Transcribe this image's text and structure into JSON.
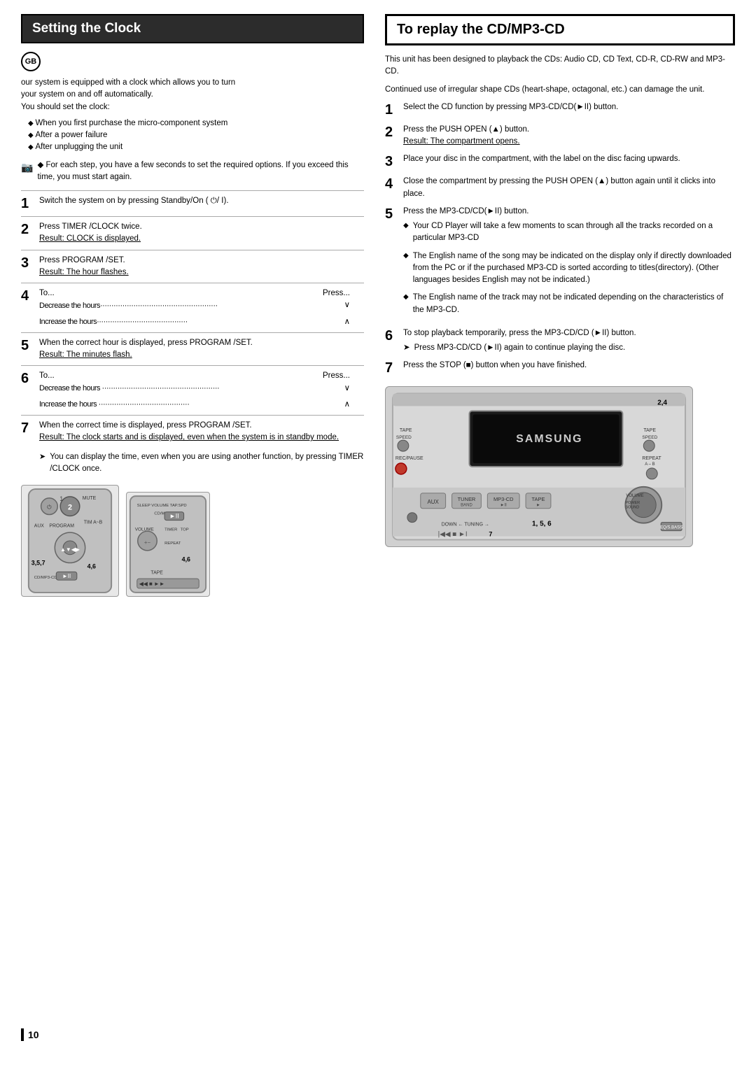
{
  "left": {
    "header": "Setting the Clock",
    "gb_label": "GB",
    "intro": [
      "our system is equipped with a clock which allows you to turn",
      "your system on and off automatically.",
      "You should set the clock:"
    ],
    "bullets": [
      "When you first purchase the micro-component system",
      "After a power failure",
      "After unplugging the unit"
    ],
    "note": "For each step, you have a few seconds to set the required options. If you exceed this time, you must start again.",
    "steps": [
      {
        "num": "1",
        "text": "Switch the system on by pressing Standby/On ( ⏻/ I)."
      },
      {
        "num": "2",
        "text": "Press TIMER /CLOCK twice.",
        "result": "Result: CLOCK is displayed."
      },
      {
        "num": "3",
        "text": "Press PROGRAM /SET.",
        "result": "Result: The hour flashes."
      },
      {
        "num": "4",
        "table": [
          {
            "action": "To...",
            "press": "Press..."
          },
          {
            "action": "Decrease the hours·····················································",
            "press": "∨"
          },
          {
            "action": "",
            "press": ""
          },
          {
            "action": "Increase the hours·········································",
            "press": "∧"
          }
        ]
      },
      {
        "num": "5",
        "text": "When the correct hour is displayed, press PROGRAM /SET.",
        "result": "Result: The minutes flash."
      },
      {
        "num": "6",
        "table": [
          {
            "action": "To...",
            "press": "Press..."
          },
          {
            "action": "Decrease the hours ·····················································",
            "press": "∨"
          },
          {
            "action": "",
            "press": ""
          },
          {
            "action": "Increase the hours ·········································",
            "press": "∧"
          }
        ]
      },
      {
        "num": "7",
        "text": "When the correct time is displayed, press PROGRAM /SET.",
        "result": "Result: The clock starts and is displayed, even when the system is in standby mode."
      }
    ],
    "footer_note": "You can display the time, even when you are using another function, by pressing  TIMER /CLOCK  once.",
    "img_labels": {
      "left_numbers": "1, 2",
      "mid_numbers": "3, 5, 7",
      "mid2_numbers": "4,6",
      "bottom_numbers": "4,6"
    }
  },
  "right": {
    "header": "To  replay the CD/MP3-CD",
    "intro1": "This unit has been designed to playback the CDs: Audio CD, CD Text, CD-R, CD-RW and MP3-CD.",
    "intro2": "Continued use of irregular shape CDs (heart-shape, octagonal, etc.) can damage the unit.",
    "steps": [
      {
        "num": "1",
        "text": "Select the CD function by pressing MP3-CD/CD(►II) button."
      },
      {
        "num": "2",
        "text": "Press the PUSH OPEN (▲) button.",
        "result": "Result: The compartment opens."
      },
      {
        "num": "3",
        "text": "Place your disc in the compartment, with the label on the disc facing upwards."
      },
      {
        "num": "4",
        "text": "Close the compartment by pressing the PUSH OPEN (▲) button again until it clicks into place."
      },
      {
        "num": "5",
        "text": "Press the MP3-CD/CD(►II) button.",
        "bullets": [
          "Your CD Player will take a few moments to scan through all the tracks recorded on a particular MP3-CD",
          "The English name of the song may be indicated on the display only if directly downloaded from the PC or if the purchased MP3-CD is sorted according to titles(directory). (Other languages besides English may not be indicated.)",
          "The English name of the track may not be indicated depending on the characteristics of the MP3-CD."
        ]
      },
      {
        "num": "6",
        "text": "To stop playback temporarily, press the MP3-CD/CD (►II) button.",
        "sub": "Press MP3-CD/CD (►II) again to continue playing the disc."
      },
      {
        "num": "7",
        "text": "Press the STOP (■) button when you have finished."
      }
    ],
    "device_label": "2,4",
    "device_numbers": "1, 5, 6",
    "device_bottom": "7"
  },
  "page_number": "10"
}
